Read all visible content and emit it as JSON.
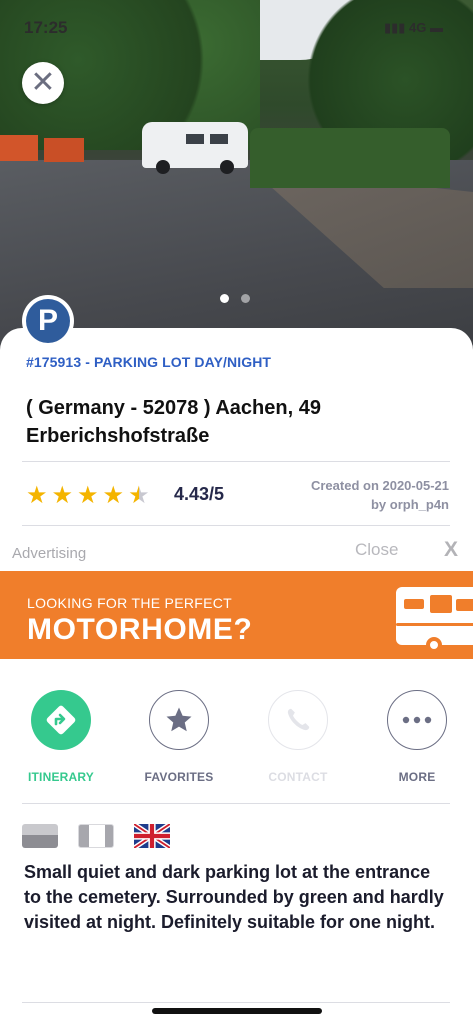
{
  "status_bar": {
    "time": "17:25",
    "network": "4G"
  },
  "photo": {
    "close_icon": "close-icon",
    "page_count": 2,
    "active_page": 1
  },
  "place": {
    "badge_letter": "P",
    "reference": "#175913 - PARKING LOT DAY/NIGHT",
    "address": "( Germany - 52078 ) Aachen, 49 Erberichshofstraße",
    "rating_value": 4.43,
    "rating_text": "4.43/5",
    "stars_max": 5,
    "created_line": "Created on 2020-05-21",
    "author_line": "by orph_p4n"
  },
  "ad": {
    "label": "Advertising",
    "close_label": "Close",
    "x_label": "X",
    "banner_small": "LOOKING FOR THE PERFECT",
    "banner_big": "MOTORHOME?"
  },
  "actions": [
    {
      "label": "ITINERARY",
      "icon": "directions-icon"
    },
    {
      "label": "FAVORITES",
      "icon": "star-icon"
    },
    {
      "label": "CONTACT",
      "icon": "phone-icon"
    },
    {
      "label": "MORE",
      "icon": "more-icon"
    }
  ],
  "description": "Small quiet and dark parking lot at the entrance to the cemetery. Surrounded by green and hardly visited at night. Definitely suitable for one night.",
  "colors": {
    "accent_blue": "#2f5fc4",
    "itinerary_green": "#35c98e",
    "banner_orange": "#f07e2b",
    "star_yellow": "#f4b400"
  }
}
